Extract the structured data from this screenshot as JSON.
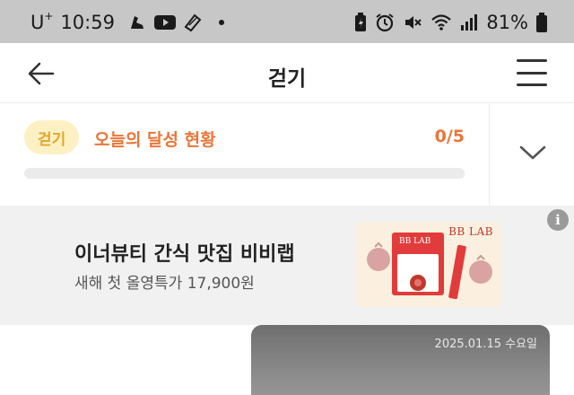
{
  "status_bar": {
    "carrier": "U",
    "carrier_sup": "+",
    "time": "10:59",
    "battery_percent": "81%",
    "icons_left": [
      "shoe-icon",
      "youtube-icon",
      "shoe-icon",
      "dot"
    ],
    "icons_right": [
      "battery-saver-icon",
      "alarm-icon",
      "mute-icon",
      "wifi-icon",
      "signal-icon",
      "battery-icon"
    ]
  },
  "header": {
    "title": "걷기",
    "back_icon": "arrow-left-icon",
    "menu_icon": "hamburger-icon"
  },
  "progress": {
    "tag": "걷기",
    "label": "오늘의 달성 현황",
    "count": "0/5",
    "fraction": 0,
    "expand_icon": "chevron-down-icon"
  },
  "ad": {
    "title": "이너뷰티 간식 맛집 비비랩",
    "subtitle": "새해 첫 올영특가 17,900원",
    "brand": "BB LAB",
    "info_icon": "info-icon"
  },
  "photo_card": {
    "date": "2025.01.15 수요일"
  },
  "colors": {
    "accent": "#e8763a",
    "tag_bg": "#fdf1c4",
    "tag_text": "#e4a528",
    "status_bar_bg": "#c7c7c7",
    "ad_bg": "#f1f1f1"
  }
}
